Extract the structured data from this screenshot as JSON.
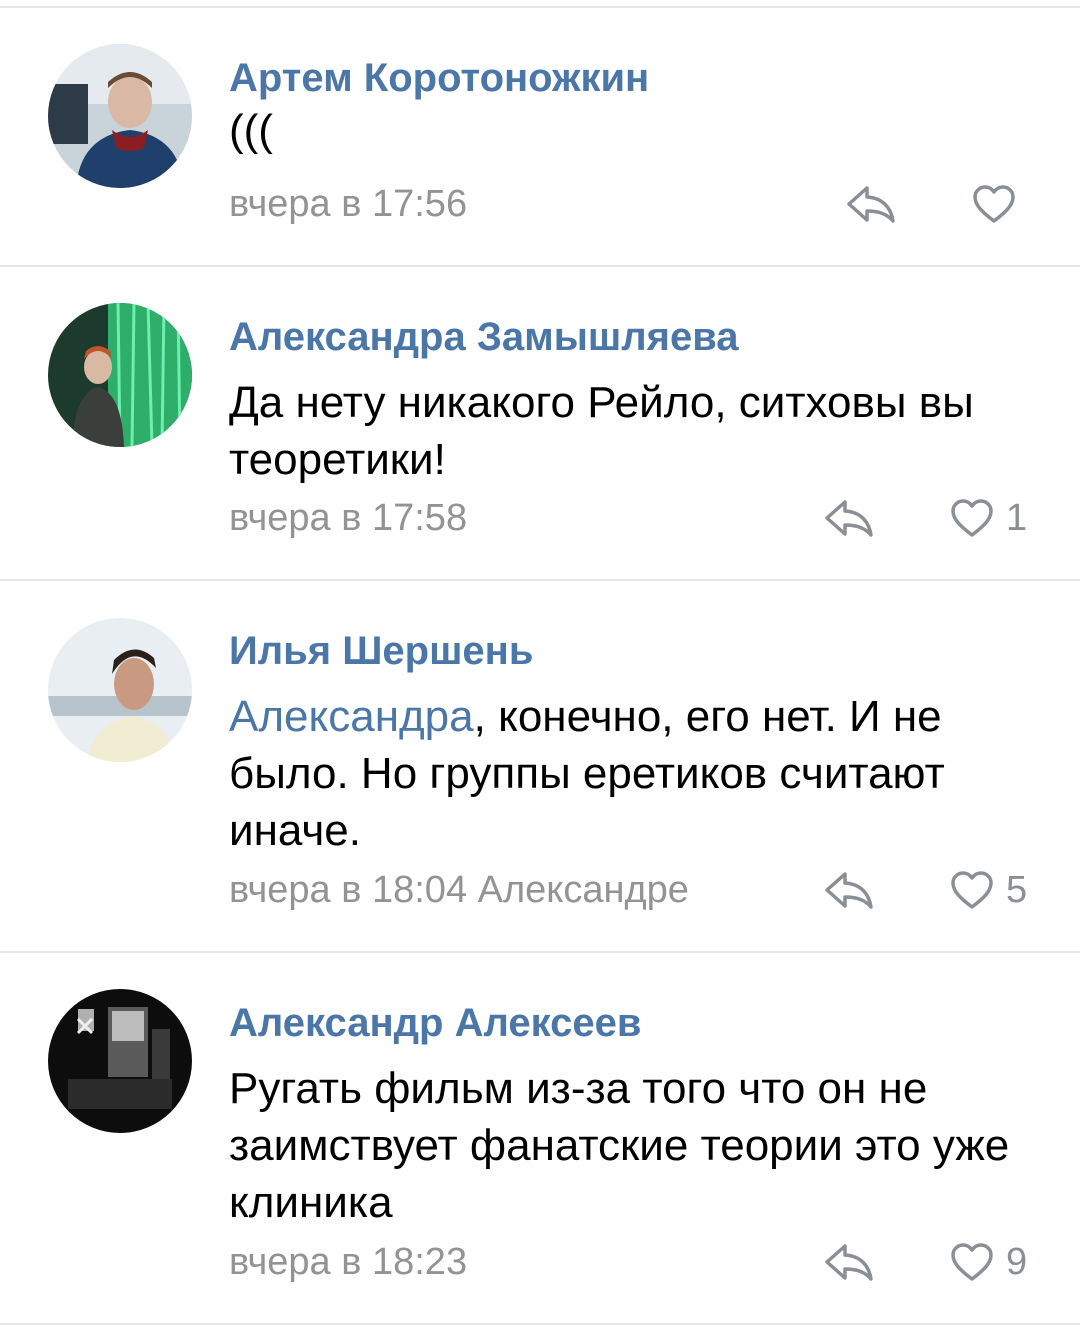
{
  "comments": [
    {
      "author": "Артем Коротоножкин",
      "text": "(((",
      "time": "вчера в 17:56",
      "reply_to": "",
      "likes": ""
    },
    {
      "author": "Александра Замышляева",
      "text": "Да нету никакого Рейло, ситховы вы теоретики!",
      "time": "вчера в 17:58",
      "reply_to": "",
      "likes": "1"
    },
    {
      "author": "Илья Шершень",
      "mention": "Александра",
      "text": ", конечно, его нет. И не было. Но группы еретиков считают иначе.",
      "time": "вчера в 18:04",
      "reply_to": "Александре",
      "likes": "5"
    },
    {
      "author": "Александр Алексеев",
      "text": "Ругать фильм из-за того что он не заимствует фанатские теории это уже клиника",
      "time": "вчера в 18:23",
      "reply_to": "",
      "likes": "9"
    }
  ],
  "icons": {
    "reply": "reply-arrow-icon",
    "like": "heart-outline-icon"
  },
  "colors": {
    "link": "#4a76a8",
    "meta": "#939393",
    "divider": "#e3e5e8",
    "icon": "#8a8f96"
  }
}
